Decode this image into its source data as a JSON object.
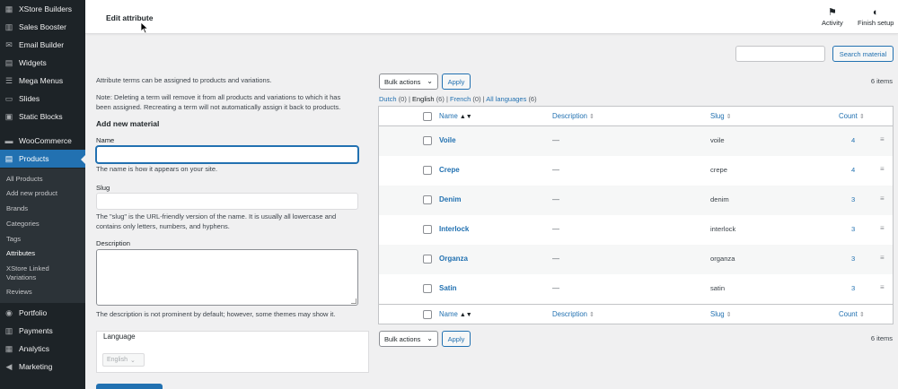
{
  "sidebar": {
    "items": [
      {
        "label": "XStore Builders",
        "icon": "grid-icon"
      },
      {
        "label": "Sales Booster",
        "icon": "chart-icon"
      },
      {
        "label": "Email Builder",
        "icon": "mail-icon"
      },
      {
        "label": "Widgets",
        "icon": "widgets-icon"
      },
      {
        "label": "Mega Menus",
        "icon": "menu-icon"
      },
      {
        "label": "Slides",
        "icon": "slides-icon"
      },
      {
        "label": "Static Blocks",
        "icon": "blocks-icon"
      },
      {
        "label": "WooCommerce",
        "icon": "woo-icon"
      },
      {
        "label": "Products",
        "icon": "archive-icon"
      },
      {
        "label": "Portfolio",
        "icon": "portfolio-icon"
      },
      {
        "label": "Payments",
        "icon": "payments-icon"
      },
      {
        "label": "Analytics",
        "icon": "analytics-icon"
      },
      {
        "label": "Marketing",
        "icon": "megaphone-icon"
      }
    ],
    "submenu": [
      "All Products",
      "Add new product",
      "Brands",
      "Categories",
      "Tags",
      "Attributes",
      "XStore Linked",
      "Variations",
      "Reviews"
    ]
  },
  "header": {
    "title": "Edit attribute",
    "activity_label": "Activity",
    "finish_label": "Finish setup"
  },
  "search": {
    "value": "",
    "button_label": "Search material"
  },
  "form": {
    "intro": "Attribute terms can be assigned to products and variations.",
    "note_line1": "Note: Deleting a term will remove it from all products and variations to which it has",
    "note_line2": "been assigned. Recreating a term will not automatically assign it back to products.",
    "heading": "Add new material",
    "name_label": "Name",
    "name_help": "The name is how it appears on your site.",
    "slug_label": "Slug",
    "slug_help_line1": "The \"slug\" is the URL-friendly version of the name. It is usually all lowercase and",
    "slug_help_line2": "contains only letters, numbers, and hyphens.",
    "desc_label": "Description",
    "desc_help": "The description is not prominent by default; however, some themes may show it.",
    "language_label": "Language",
    "language_value": "English"
  },
  "table": {
    "bulk_label": "Bulk actions",
    "apply_label": "Apply",
    "items_count": "6 items",
    "lang_filter": {
      "dutch": "Dutch",
      "dutch_count": "(0)",
      "english": "English",
      "english_count": "(6)",
      "french": "French",
      "french_count": "(0)",
      "all": "All languages",
      "all_count": "(6)"
    },
    "columns": {
      "name": "Name",
      "description": "Description",
      "slug": "Slug",
      "count": "Count"
    },
    "rows": [
      {
        "name": "Voile",
        "description": "—",
        "slug": "voile",
        "count": "4"
      },
      {
        "name": "Crepe",
        "description": "—",
        "slug": "crepe",
        "count": "4"
      },
      {
        "name": "Denim",
        "description": "—",
        "slug": "denim",
        "count": "3"
      },
      {
        "name": "Interlock",
        "description": "—",
        "slug": "interlock",
        "count": "3"
      },
      {
        "name": "Organza",
        "description": "—",
        "slug": "organza",
        "count": "3"
      },
      {
        "name": "Satin",
        "description": "—",
        "slug": "satin",
        "count": "3"
      }
    ]
  }
}
